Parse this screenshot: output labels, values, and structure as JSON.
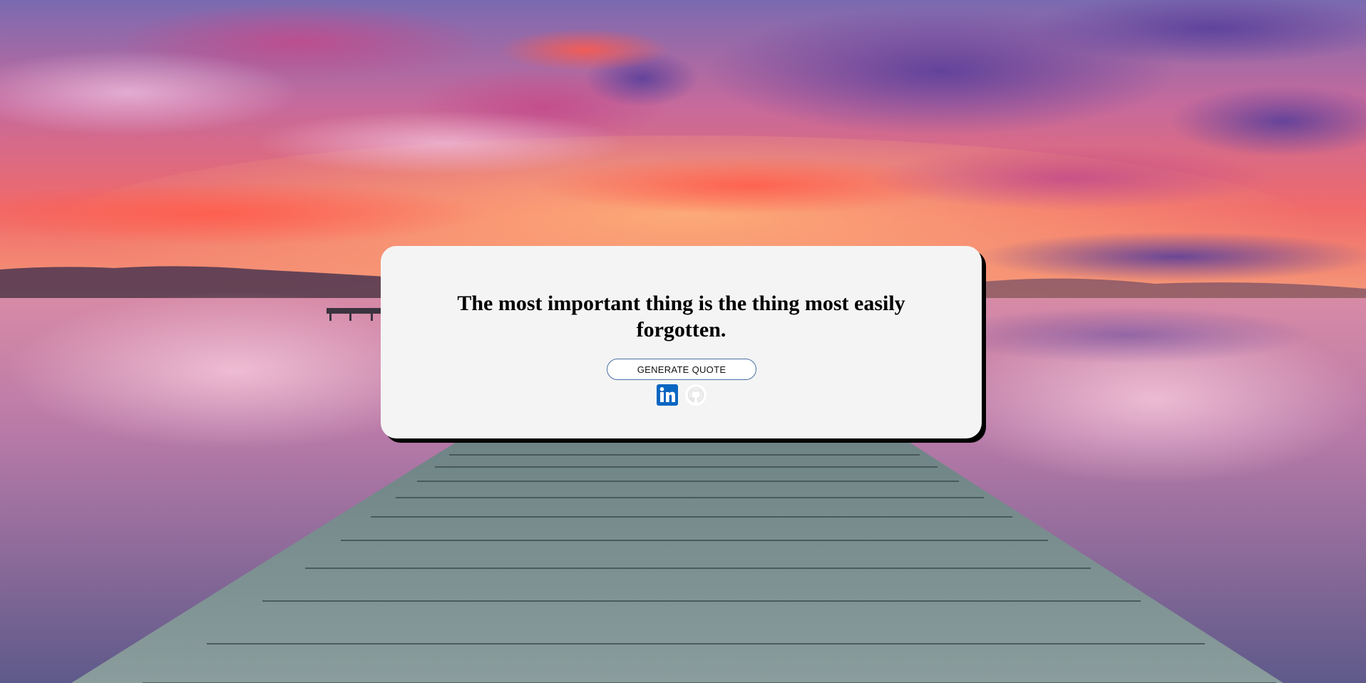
{
  "quote": {
    "text": "The most important thing is the thing most easily forgotten."
  },
  "actions": {
    "generate_label": "GENERATE QUOTE"
  },
  "socials": [
    {
      "icon": "linkedin-icon",
      "color": "#0a66c2"
    },
    {
      "icon": "github-icon",
      "color": "#ffffff"
    }
  ],
  "colors": {
    "card_background": "#f4f4f4",
    "card_shadow": "#000000",
    "button_border": "#4a6fa5"
  }
}
